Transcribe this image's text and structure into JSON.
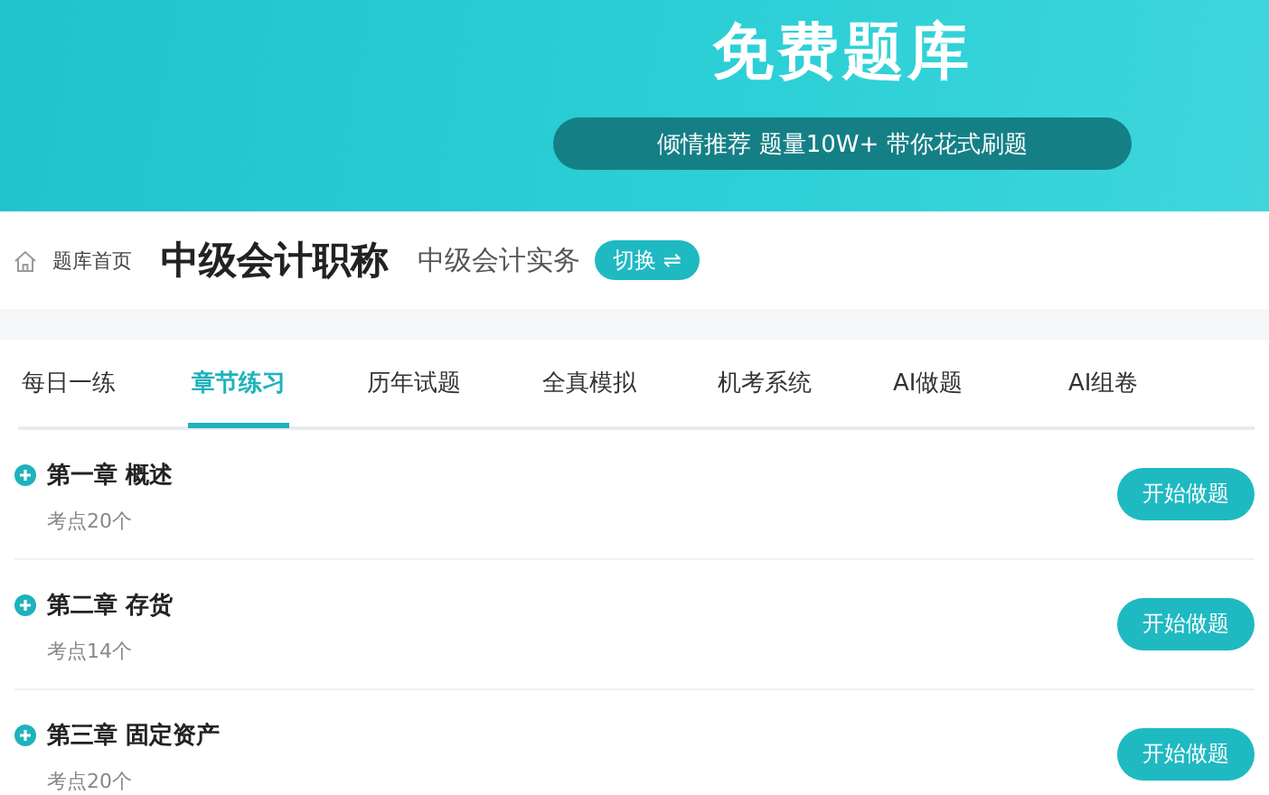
{
  "banner": {
    "title": "免费题库",
    "slogan": "倾情推荐 题量10W+ 带你花式刷题"
  },
  "header": {
    "breadcrumb": "题库首页",
    "exam": "中级会计职称",
    "subject": "中级会计实务",
    "switch_button": "切换 ⇌"
  },
  "tabs": [
    {
      "label": "每日一练",
      "selected": false
    },
    {
      "label": "章节练习",
      "selected": true
    },
    {
      "label": "历年试题",
      "selected": false
    },
    {
      "label": "全真模拟",
      "selected": false
    },
    {
      "label": "机考系统",
      "selected": false
    },
    {
      "label": "AI做题",
      "selected": false
    },
    {
      "label": "AI组卷",
      "selected": false
    }
  ],
  "chapters": [
    {
      "title": "第一章 概述",
      "points": "考点20个",
      "button": "开始做题"
    },
    {
      "title": "第二章 存货",
      "points": "考点14个",
      "button": "开始做题"
    },
    {
      "title": "第三章 固定资产",
      "points": "考点20个",
      "button": "开始做题"
    }
  ]
}
